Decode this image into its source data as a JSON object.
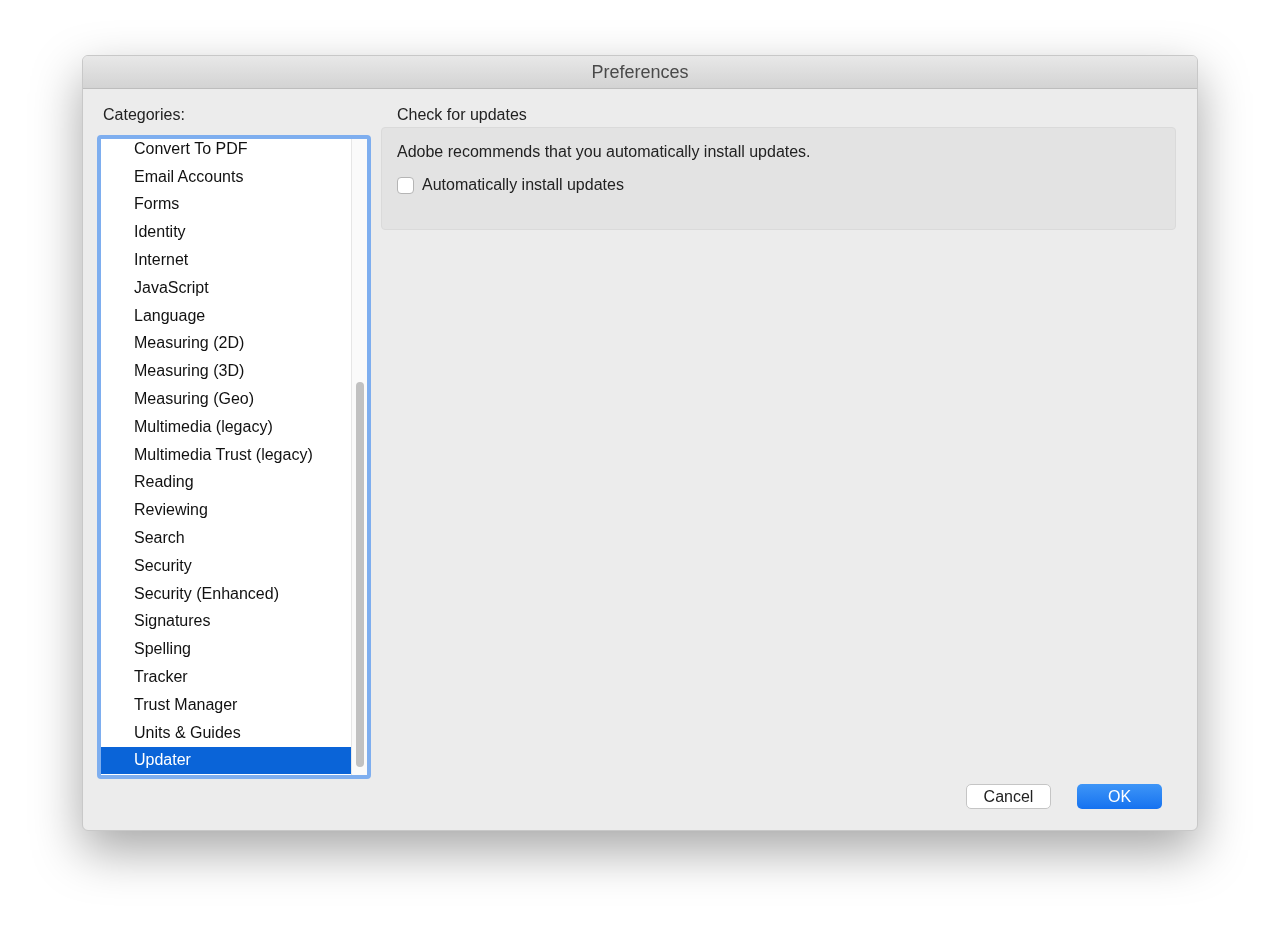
{
  "window": {
    "title": "Preferences"
  },
  "categories": {
    "label": "Categories:",
    "items": [
      {
        "label": "Convert To PDF",
        "selected": false
      },
      {
        "label": "Email Accounts",
        "selected": false
      },
      {
        "label": "Forms",
        "selected": false
      },
      {
        "label": "Identity",
        "selected": false
      },
      {
        "label": "Internet",
        "selected": false
      },
      {
        "label": "JavaScript",
        "selected": false
      },
      {
        "label": "Language",
        "selected": false
      },
      {
        "label": "Measuring (2D)",
        "selected": false
      },
      {
        "label": "Measuring (3D)",
        "selected": false
      },
      {
        "label": "Measuring (Geo)",
        "selected": false
      },
      {
        "label": "Multimedia (legacy)",
        "selected": false
      },
      {
        "label": "Multimedia Trust (legacy)",
        "selected": false
      },
      {
        "label": "Reading",
        "selected": false
      },
      {
        "label": "Reviewing",
        "selected": false
      },
      {
        "label": "Search",
        "selected": false
      },
      {
        "label": "Security",
        "selected": false
      },
      {
        "label": "Security (Enhanced)",
        "selected": false
      },
      {
        "label": "Signatures",
        "selected": false
      },
      {
        "label": "Spelling",
        "selected": false
      },
      {
        "label": "Tracker",
        "selected": false
      },
      {
        "label": "Trust Manager",
        "selected": false
      },
      {
        "label": "Units & Guides",
        "selected": false
      },
      {
        "label": "Updater",
        "selected": true
      }
    ]
  },
  "section": {
    "title": "Check for updates",
    "description": "Adobe recommends that you automatically install updates.",
    "checkbox": {
      "label": "Automatically install updates",
      "checked": false
    }
  },
  "buttons": [
    {
      "label": "Cancel",
      "kind": "default"
    },
    {
      "label": "OK",
      "kind": "primary"
    }
  ]
}
